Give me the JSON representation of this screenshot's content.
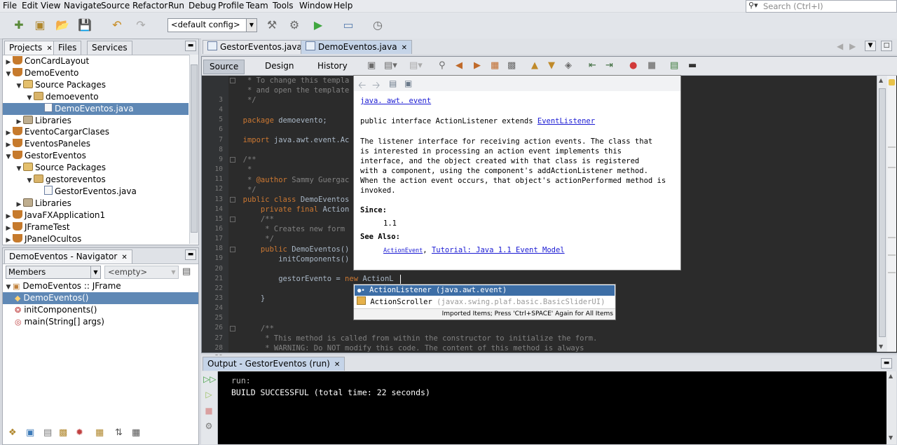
{
  "menubar": [
    "File",
    "Edit",
    "View",
    "Navigate",
    "Source",
    "Refactor",
    "Run",
    "Debug",
    "Profile",
    "Team",
    "Tools",
    "Window",
    "Help"
  ],
  "search": {
    "placeholder": "Search (Ctrl+I)"
  },
  "toolbar": {
    "config": "<default config>"
  },
  "projects_panel": {
    "tabs": [
      "Projects",
      "Files",
      "Services"
    ],
    "tree": [
      {
        "label": "ConCardLayout",
        "depth": 0,
        "expanded": false,
        "icon": "coffee"
      },
      {
        "label": "DemoEvento",
        "depth": 0,
        "expanded": true,
        "icon": "coffee"
      },
      {
        "label": "Source Packages",
        "depth": 1,
        "expanded": true,
        "icon": "src"
      },
      {
        "label": "demoevento",
        "depth": 2,
        "expanded": true,
        "icon": "pkg"
      },
      {
        "label": "DemoEventos.java",
        "depth": 3,
        "expanded": null,
        "icon": "java",
        "selected": true
      },
      {
        "label": "Libraries",
        "depth": 1,
        "expanded": false,
        "icon": "lib"
      },
      {
        "label": "EventoCargarClases",
        "depth": 0,
        "expanded": false,
        "icon": "coffee"
      },
      {
        "label": "EventosPaneles",
        "depth": 0,
        "expanded": false,
        "icon": "coffee"
      },
      {
        "label": "GestorEventos",
        "depth": 0,
        "expanded": true,
        "icon": "coffee"
      },
      {
        "label": "Source Packages",
        "depth": 1,
        "expanded": true,
        "icon": "src"
      },
      {
        "label": "gestoreventos",
        "depth": 2,
        "expanded": true,
        "icon": "pkg"
      },
      {
        "label": "GestorEventos.java",
        "depth": 3,
        "expanded": null,
        "icon": "java"
      },
      {
        "label": "Libraries",
        "depth": 1,
        "expanded": false,
        "icon": "lib"
      },
      {
        "label": "JavaFXApplication1",
        "depth": 0,
        "expanded": false,
        "icon": "coffee"
      },
      {
        "label": "JFrameTest",
        "depth": 0,
        "expanded": false,
        "icon": "coffee"
      },
      {
        "label": "JPanelOcultos",
        "depth": 0,
        "expanded": false,
        "icon": "coffee"
      }
    ]
  },
  "navigator": {
    "title": "DemoEventos - Navigator",
    "filter": "Members",
    "empty": "<empty>",
    "items": [
      {
        "label": "DemoEventos :: JFrame",
        "depth": 0,
        "muted_suffix": true
      },
      {
        "label": "DemoEventos()",
        "depth": 1,
        "selected": true
      },
      {
        "label": "initComponents()",
        "depth": 1
      },
      {
        "label": "main(String[] args)",
        "depth": 1
      }
    ]
  },
  "editor": {
    "tabs": [
      {
        "label": "GestorEventos.java"
      },
      {
        "label": "DemoEventos.java",
        "active": true
      }
    ],
    "views": [
      "Source",
      "Design",
      "History"
    ],
    "active_view": "Source",
    "lines": [
      {
        "n": "3",
        "segments": [
          {
            "t": "   * To change this templa",
            "c": "cm"
          }
        ]
      },
      {
        "n": "4",
        "segments": [
          {
            "t": "   * and open the template",
            "c": "cm"
          }
        ]
      },
      {
        "n": "5",
        "segments": [
          {
            "t": "   */",
            "c": "cm"
          }
        ]
      },
      {
        "n": "6",
        "segments": [
          {
            "t": "",
            "c": ""
          }
        ]
      },
      {
        "n": "7",
        "segments": [
          {
            "t": "  package ",
            "c": "kw"
          },
          {
            "t": "demoevento;",
            "c": ""
          }
        ]
      },
      {
        "n": "8",
        "segments": [
          {
            "t": "",
            "c": ""
          }
        ]
      },
      {
        "n": "9",
        "segments": [
          {
            "t": "  import ",
            "c": "kw"
          },
          {
            "t": "java.awt.event.Ac",
            "c": ""
          }
        ]
      },
      {
        "n": "10",
        "segments": [
          {
            "t": "",
            "c": ""
          }
        ]
      },
      {
        "n": "11",
        "segments": [
          {
            "t": "  /**",
            "c": "cm"
          }
        ]
      },
      {
        "n": "12",
        "segments": [
          {
            "t": "   *",
            "c": "cm"
          }
        ]
      },
      {
        "n": "13",
        "segments": [
          {
            "t": "   * ",
            "c": "cm"
          },
          {
            "t": "@author",
            "c": "tg"
          },
          {
            "t": " Sammy Guergac",
            "c": "cm"
          }
        ]
      },
      {
        "n": "14",
        "segments": [
          {
            "t": "   */",
            "c": "cm"
          }
        ]
      },
      {
        "n": "15",
        "segments": [
          {
            "t": "  public class ",
            "c": "kw"
          },
          {
            "t": "DemoEventos",
            "c": ""
          }
        ]
      },
      {
        "n": "16",
        "segments": [
          {
            "t": "      private final ",
            "c": "kw"
          },
          {
            "t": "Action",
            "c": ""
          }
        ]
      },
      {
        "n": "17",
        "segments": [
          {
            "t": "      /**",
            "c": "cm"
          }
        ]
      },
      {
        "n": "18",
        "segments": [
          {
            "t": "       * Creates new form",
            "c": "cm"
          }
        ]
      },
      {
        "n": "19",
        "segments": [
          {
            "t": "       */",
            "c": "cm"
          }
        ]
      },
      {
        "n": "20",
        "segments": [
          {
            "t": "      public ",
            "c": "kw"
          },
          {
            "t": "DemoEventos()",
            "c": ""
          }
        ]
      },
      {
        "n": "21",
        "segments": [
          {
            "t": "          initComponents()",
            "c": ""
          }
        ]
      },
      {
        "n": "22",
        "segments": [
          {
            "t": "",
            "c": ""
          }
        ]
      },
      {
        "n": "23",
        "segments": [
          {
            "t": "          gestorEvento = ",
            "c": ""
          },
          {
            "t": "new ",
            "c": "kw"
          },
          {
            "t": "ActionL",
            "c": ""
          }
        ]
      },
      {
        "n": "24",
        "segments": [
          {
            "t": "",
            "c": ""
          }
        ]
      },
      {
        "n": "25",
        "segments": [
          {
            "t": "      }",
            "c": ""
          }
        ]
      },
      {
        "n": "26",
        "segments": [
          {
            "t": "",
            "c": ""
          }
        ]
      },
      {
        "n": "27",
        "segments": [
          {
            "t": "",
            "c": ""
          }
        ]
      },
      {
        "n": "28",
        "segments": [
          {
            "t": "      /**",
            "c": "cm"
          }
        ]
      },
      {
        "n": "29",
        "segments": [
          {
            "t": "       * This method is called from within the constructor to initialize the form.",
            "c": "cm"
          }
        ]
      },
      {
        "n": "30",
        "segments": [
          {
            "t": "       * WARNING: Do NOT modify this code. The content of this method is always",
            "c": "cm"
          }
        ]
      }
    ]
  },
  "javadoc": {
    "package_link": "java. awt. event",
    "signature_prefix": "public interface ActionListener extends ",
    "signature_link": "EventListener",
    "description": [
      "The listener interface for receiving action events. The class that",
      "is interested in processing an action event implements this",
      "interface, and the object created with that class is registered",
      "with a component, using the component's addActionListener method.",
      "When the action event occurs, that object's actionPerformed method is",
      "invoked."
    ],
    "since_label": "Since:",
    "since_value": "1.1",
    "see_also_label": "See Also:",
    "see_also_link1": "ActionEvent",
    "see_also_sep": ", ",
    "see_also_link2": "Tutorial: Java 1.1 Event Model"
  },
  "completion": {
    "items": [
      {
        "name": "ActionListener",
        "pkg": "(java.awt.event)",
        "selected": true
      },
      {
        "name": "ActionScroller",
        "pkg": "(javax.swing.plaf.basic.BasicSliderUI)"
      }
    ],
    "footer": "Imported Items; Press 'Ctrl+SPACE' Again for All Items"
  },
  "output": {
    "tab": "Output - GestorEventos (run)",
    "lines": [
      {
        "text": "run:",
        "color": "#b8b8b8"
      },
      {
        "text": "BUILD SUCCESSFUL (total time: 22 seconds)",
        "color": "#ffffff"
      }
    ]
  }
}
